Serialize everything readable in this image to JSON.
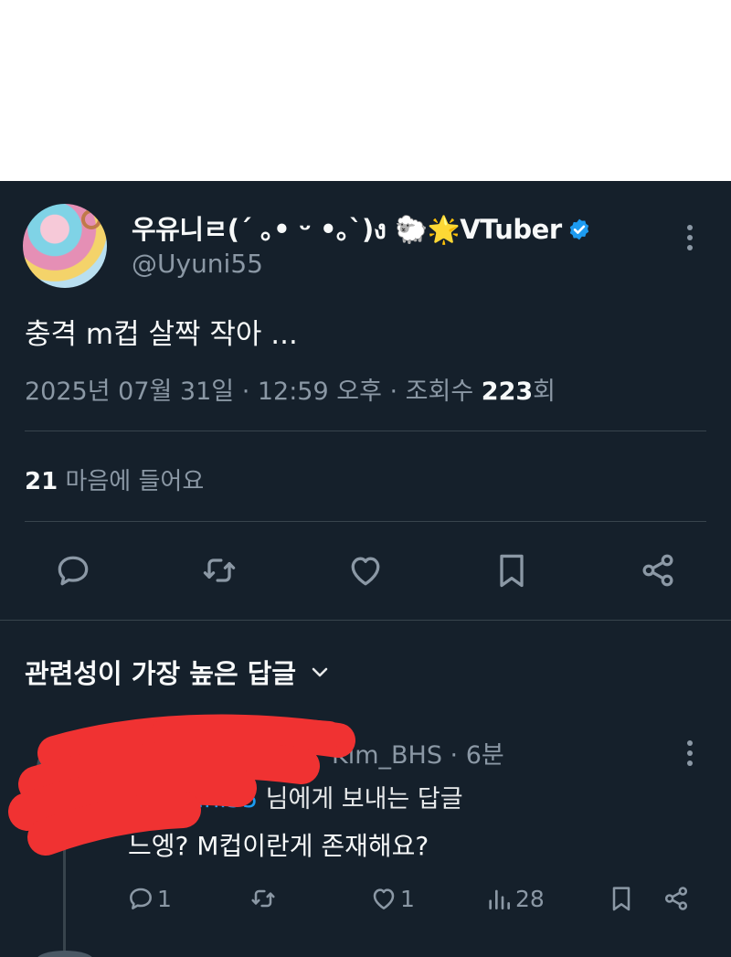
{
  "tweet": {
    "display_name": "우유니ㄹ(´ ｡• ᵕ •｡`)ง 🐑🌟VTuber",
    "handle": "@Uyuni55",
    "text": "충격 m컵 살짝 작아 ...",
    "date_prefix": "2025년 07월 31일 · 12:59 오후 · 조회수 ",
    "views": "223",
    "views_suffix": "회",
    "likes_count": "21",
    "likes_label": " 마음에 들어요"
  },
  "actions": {
    "reply": "reply-icon",
    "retweet": "retweet-icon",
    "like": "heart-icon",
    "bookmark": "bookmark-icon",
    "share": "share-icon"
  },
  "replies_section": {
    "title": "관련성이 가장 높은 답글"
  },
  "reply": {
    "handle_time": "Kim_BHS · 6분",
    "reply_to_mention": "yuni55",
    "reply_to_suffix": " 님에게 보내는 답글",
    "text": "느엥? M컵이란게 존재해요?",
    "reply_count": "1",
    "like_count": "1",
    "view_count": "28"
  },
  "colors": {
    "background": "#15202b",
    "accent": "#1d9bf0",
    "muted": "#8b98a5",
    "redaction": "#f03232"
  }
}
